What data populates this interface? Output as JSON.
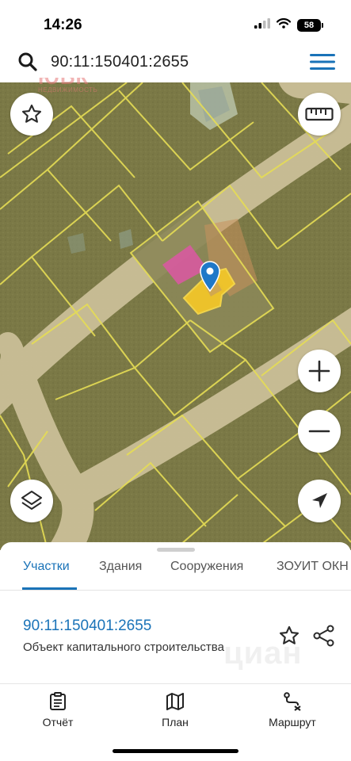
{
  "status": {
    "time": "14:26",
    "battery": "58"
  },
  "search": {
    "query": "90:11:150401:2655"
  },
  "watermark": {
    "logo": "ЮБК",
    "subtitle": "НЕДВИЖИМОСТЬ"
  },
  "map": {
    "icons": {
      "favorite": "star-icon",
      "ruler": "ruler-icon",
      "zoom_in": "plus-icon",
      "zoom_out": "minus-icon",
      "layers": "layers-icon",
      "locate": "location-arrow-icon",
      "pin": "map-pin-icon"
    },
    "colors": {
      "terrain": "#7d7a48",
      "road": "#cfc29a",
      "parcel_lines": "#e6dd55",
      "selected_parcel": "#f2c629",
      "building": "#d85aa0",
      "pin": "#1f78c8"
    }
  },
  "sheet": {
    "tabs": [
      {
        "label": "Участки",
        "active": true
      },
      {
        "label": "Здания",
        "active": false
      },
      {
        "label": "Сооружения",
        "active": false
      },
      {
        "label": "ЗОУИТ ОКН",
        "active": false
      }
    ],
    "parcel_id": "90:11:150401:2655",
    "parcel_type": "Объект капитального строительства",
    "watermark": "циан"
  },
  "nav": {
    "items": [
      {
        "label": "Отчёт",
        "icon": "report-icon"
      },
      {
        "label": "План",
        "icon": "map-icon"
      },
      {
        "label": "Маршрут",
        "icon": "route-icon"
      }
    ]
  },
  "accent_color": "#1a73b8"
}
